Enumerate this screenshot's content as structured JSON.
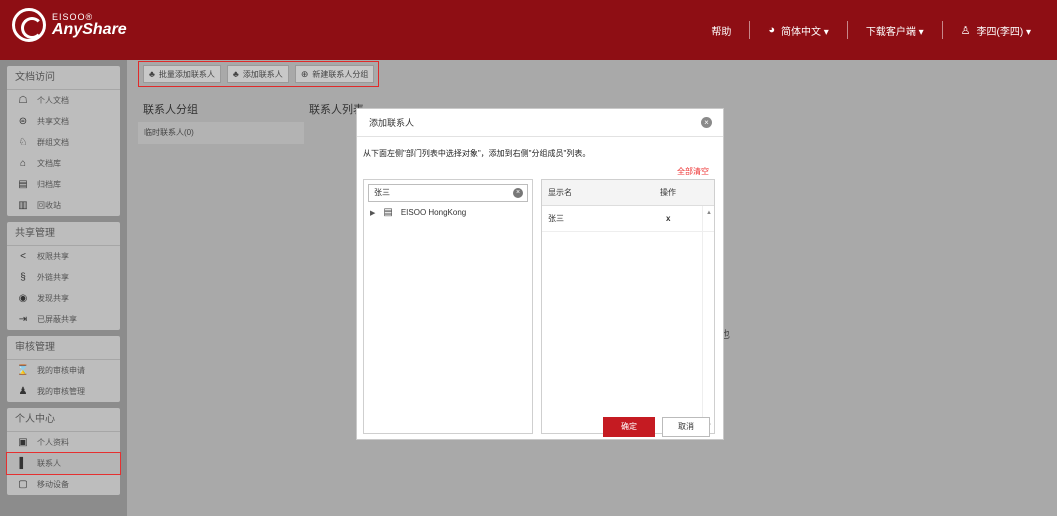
{
  "brand": {
    "small": "EISOO®",
    "big": "AnyShare"
  },
  "topnav": {
    "help": "帮助",
    "language": "简体中文 ▾",
    "download": "下载客户端 ▾",
    "user": "李四(李四) ▾"
  },
  "toolbar": {
    "batch_add": "批量添加联系人",
    "add_contact": "添加联系人",
    "new_group": "新建联系人分组"
  },
  "sidebar": {
    "sections": [
      {
        "title": "文档访问",
        "items": [
          "个人文档",
          "共享文档",
          "群组文档",
          "文档库",
          "归档库",
          "回收站"
        ]
      },
      {
        "title": "共享管理",
        "items": [
          "权限共享",
          "外链共享",
          "发现共享",
          "已屏蔽共享"
        ]
      },
      {
        "title": "审核管理",
        "items": [
          "我的审核申请",
          "我的审核管理"
        ]
      },
      {
        "title": "个人中心",
        "items": [
          "个人资料",
          "联系人",
          "移动设备"
        ]
      }
    ]
  },
  "main": {
    "group_heading": "联系人分组",
    "list_heading": "联系人列表",
    "group_row": "临时联系人(0)",
    "stray_text": "也"
  },
  "dialog": {
    "title": "添加联系人",
    "hint": "从下面左侧\"部门列表中选择对象\"，添加到右侧\"分组成员\"列表。",
    "clear_all": "全部清空",
    "search_value": "张三",
    "tree_item": "EISOO HongKong",
    "col_name": "显示名",
    "col_action": "操作",
    "rows": [
      {
        "name": "张三",
        "action": "x"
      }
    ],
    "ok": "确定",
    "cancel": "取消"
  },
  "colors": {
    "brand_red": "#8e0e14",
    "button_red": "#c51b22",
    "accent_red": "#e33333"
  }
}
